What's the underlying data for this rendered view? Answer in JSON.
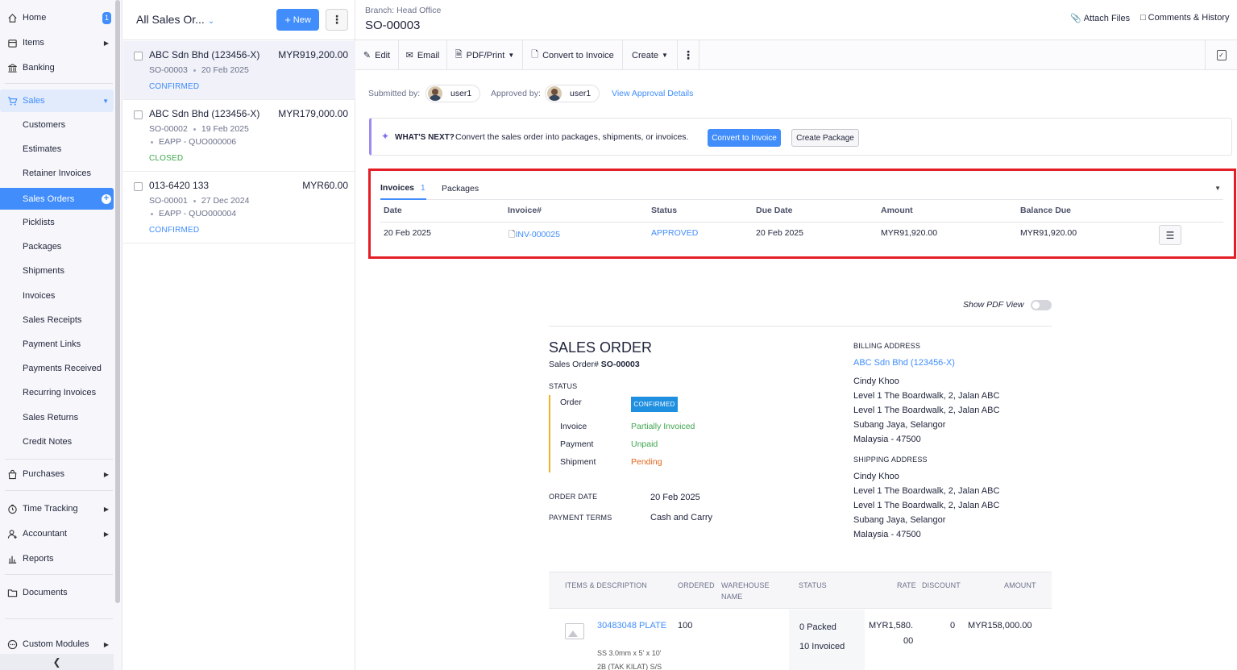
{
  "sidebar": {
    "items": {
      "home": {
        "label": "Home",
        "badge": "1"
      },
      "items": {
        "label": "Items"
      },
      "banking": {
        "label": "Banking"
      },
      "sales": {
        "label": "Sales"
      },
      "purchases": {
        "label": "Purchases"
      },
      "time_tracking": {
        "label": "Time Tracking"
      },
      "accountant": {
        "label": "Accountant"
      },
      "reports": {
        "label": "Reports"
      },
      "documents": {
        "label": "Documents"
      },
      "custom_modules": {
        "label": "Custom Modules"
      }
    },
    "sales_sub": [
      "Customers",
      "Estimates",
      "Retainer Invoices",
      "Sales Orders",
      "Picklists",
      "Packages",
      "Shipments",
      "Invoices",
      "Sales Receipts",
      "Payment Links",
      "Payments Received",
      "Recurring Invoices",
      "Sales Returns",
      "Credit Notes"
    ],
    "active_sub": "Sales Orders"
  },
  "list": {
    "title": "All Sales Or...",
    "new_label": "New",
    "rows": [
      {
        "customer": "ABC Sdn Bhd (123456-X)",
        "amount": "MYR919,200.00",
        "number": "SO-00003",
        "date": "20 Feb 2025",
        "ref": "",
        "status": "CONFIRMED",
        "status_color": "#408dfb"
      },
      {
        "customer": "ABC Sdn Bhd (123456-X)",
        "amount": "MYR179,000.00",
        "number": "SO-00002",
        "date": "19 Feb 2025",
        "ref": "EAPP - QUO000006",
        "status": "CLOSED",
        "status_color": "#3fa64f"
      },
      {
        "customer": "013-6420 133",
        "amount": "MYR60.00",
        "number": "SO-00001",
        "date": "27 Dec 2024",
        "ref": "EAPP - QUO000004",
        "status": "CONFIRMED",
        "status_color": "#408dfb"
      }
    ]
  },
  "detail": {
    "branch": "Branch: Head Office",
    "number": "SO-00003",
    "attach_files": "Attach Files",
    "comments_history": "Comments & History",
    "toolbar": {
      "edit": "Edit",
      "email": "Email",
      "pdf_print": "PDF/Print",
      "convert_to_invoice": "Convert to Invoice",
      "create": "Create"
    },
    "approval": {
      "submitted_label": "Submitted by:",
      "submitted_user": "user1",
      "approved_label": "Approved by:",
      "approved_user": "user1",
      "view_details": "View Approval Details"
    },
    "whats_next": {
      "title": "WHAT'S NEXT?",
      "text": "Convert the sales order into packages, shipments, or invoices.",
      "primary": "Convert to Invoice",
      "secondary": "Create Package"
    },
    "related": {
      "tabs": [
        {
          "label": "Invoices",
          "count": "1"
        },
        {
          "label": "Packages",
          "count": ""
        }
      ],
      "columns": [
        "Date",
        "Invoice#",
        "Status",
        "Due Date",
        "Amount",
        "Balance Due"
      ],
      "rows": [
        {
          "date": "20 Feb 2025",
          "invoice": "INV-000025",
          "status": "APPROVED",
          "due_date": "20 Feb 2025",
          "amount": "MYR91,920.00",
          "balance_due": "MYR91,920.00"
        }
      ]
    },
    "document": {
      "pdf_toggle": "Show PDF View",
      "title": "SALES ORDER",
      "order_label": "Sales Order#",
      "order_number": "SO-00003",
      "status_label": "STATUS",
      "statuses": [
        {
          "name": "Order",
          "value": "CONFIRMED"
        },
        {
          "name": "Invoice",
          "value": "Partially Invoiced"
        },
        {
          "name": "Payment",
          "value": "Unpaid"
        },
        {
          "name": "Shipment",
          "value": "Pending"
        }
      ],
      "order_date_label": "ORDER DATE",
      "order_date": "20 Feb 2025",
      "payment_terms_label": "PAYMENT TERMS",
      "payment_terms": "Cash and Carry",
      "billing_label": "BILLING ADDRESS",
      "billing_name": "ABC Sdn Bhd (123456-X)",
      "billing_lines": [
        "Cindy Khoo",
        "Level 1 The Boardwalk, 2, Jalan ABC",
        "Level 1 The Boardwalk, 2, Jalan ABC",
        "Subang Jaya, Selangor",
        "Malaysia - 47500"
      ],
      "shipping_label": "SHIPPING ADDRESS",
      "shipping_lines": [
        "Cindy Khoo",
        "Level 1 The Boardwalk, 2, Jalan ABC",
        "Level 1 The Boardwalk, 2, Jalan ABC",
        "Subang Jaya, Selangor",
        "Malaysia - 47500"
      ],
      "item_columns": {
        "items": "ITEMS & DESCRIPTION",
        "ordered": "ORDERED",
        "warehouse": "WAREHOUSE",
        "warehouse2": "NAME",
        "status": "STATUS",
        "rate": "RATE",
        "discount": "DISCOUNT",
        "amount": "AMOUNT"
      },
      "item": {
        "code": "30483048 PLATE",
        "desc1": "SS 3.0mm x 5' x 10'",
        "desc2": "2B (TAK KILAT) S/S",
        "ordered": "100",
        "packed": "0 Packed",
        "invoiced": "10 Invoiced",
        "rate1": "MYR1,580.",
        "rate2": "00",
        "discount": "0",
        "amount": "MYR158,000.00"
      }
    }
  }
}
